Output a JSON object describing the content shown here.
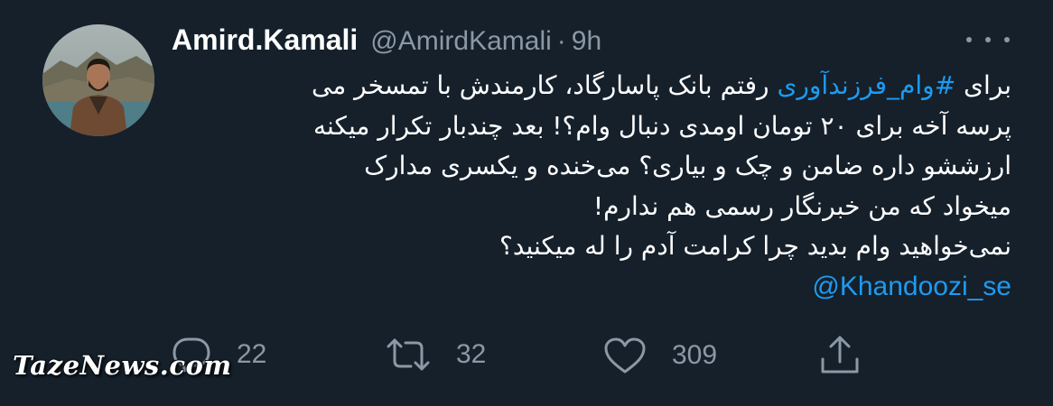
{
  "tweet": {
    "author": {
      "display_name": "Amird.Kamali",
      "handle": "@AmirdKamali",
      "separator": "·",
      "time": "9h"
    },
    "text_lines": [
      {
        "prefix": "برای ",
        "hashtag": "#وام_فرزندآوری",
        "suffix": " رفتم بانک پاسارگاد، کارمندش با تمسخر می"
      },
      {
        "text": "پرسه آخه برای ۲۰ تومان اومدی دنبال وام؟! بعد چندبار تکرار میکنه"
      },
      {
        "text": "ارزششو داره ضامن و چک و بیاری؟ می‌خنده و یکسری مدارک"
      },
      {
        "text": "میخواد که من خبرنگار رسمی هم ندارم!"
      },
      {
        "text": "نمی‌خواهید وام بدید چرا کرامت آدم را له میکنید؟"
      }
    ],
    "mention": "@Khandoozi_se",
    "actions": {
      "reply_count": "22",
      "retweet_count": "32",
      "like_count": "309"
    }
  },
  "watermark": "TazeNews.com",
  "colors": {
    "background": "#15202b",
    "text": "#ffffff",
    "secondary": "#8b98a5",
    "accent": "#1d9bf0"
  },
  "icons": [
    "more-icon",
    "reply-icon",
    "retweet-icon",
    "like-icon",
    "share-icon"
  ]
}
